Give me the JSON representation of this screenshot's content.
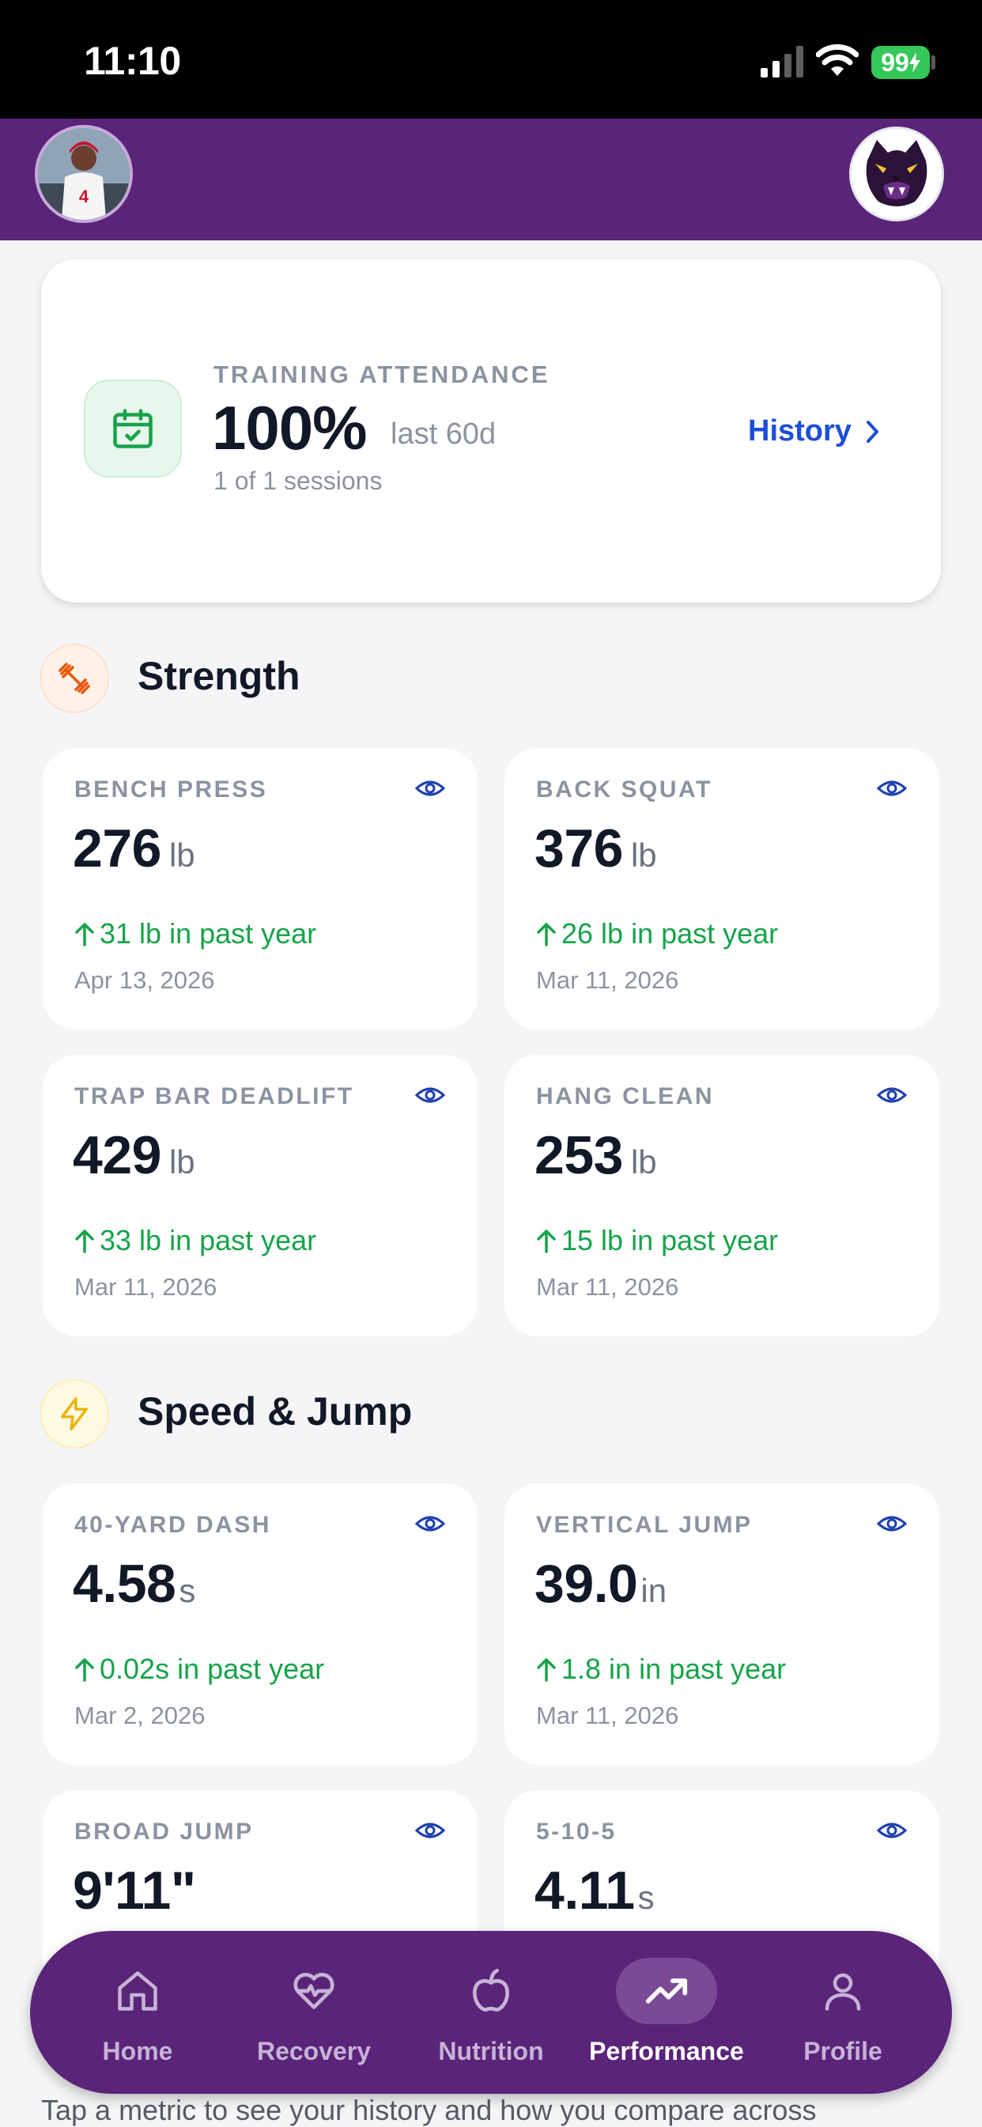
{
  "status_bar": {
    "time": "11:10",
    "battery": "99"
  },
  "attendance": {
    "label": "TRAINING ATTENDANCE",
    "value": "100%",
    "period": "last 60d",
    "sessions": "1 of 1 sessions",
    "history_label": "History"
  },
  "sections": {
    "strength": {
      "title": "Strength"
    },
    "speed": {
      "title": "Speed & Jump"
    }
  },
  "metrics": {
    "bench_press": {
      "label": "BENCH PRESS",
      "value": "276",
      "unit": "lb",
      "change": "31 lb in past year",
      "date": "Apr 13, 2026"
    },
    "back_squat": {
      "label": "BACK SQUAT",
      "value": "376",
      "unit": "lb",
      "change": "26 lb in past year",
      "date": "Mar 11, 2026"
    },
    "trap_bar_deadlift": {
      "label": "TRAP BAR DEADLIFT",
      "value": "429",
      "unit": "lb",
      "change": "33 lb in past year",
      "date": "Mar 11, 2026"
    },
    "hang_clean": {
      "label": "HANG CLEAN",
      "value": "253",
      "unit": "lb",
      "change": "15 lb in past year",
      "date": "Mar 11, 2026"
    },
    "forty_yard_dash": {
      "label": "40-YARD DASH",
      "value": "4.58",
      "unit": "s",
      "change": "0.02s in past year",
      "date": "Mar 2, 2026"
    },
    "vertical_jump": {
      "label": "VERTICAL JUMP",
      "value": "39.0",
      "unit": "in",
      "change": "1.8 in in past year",
      "date": "Mar 11, 2026"
    },
    "broad_jump": {
      "label": "BROAD JUMP",
      "value": "9'11\""
    },
    "five_ten_five": {
      "label": "5-10-5",
      "value": "4.11",
      "unit": "s"
    }
  },
  "hint": "Tap a metric to see your history and how you compare across",
  "nav": {
    "home": "Home",
    "recovery": "Recovery",
    "nutrition": "Nutrition",
    "performance": "Performance",
    "profile": "Profile",
    "active": "performance"
  },
  "colors": {
    "brand_purple": "#5a2479",
    "accent_blue": "#1d4ed8",
    "positive_green": "#16a34a",
    "muted_text": "#8b93a1"
  },
  "icons": {
    "attendance": "calendar-check-icon",
    "strength": "dumbbell-icon",
    "speed": "lightning-icon",
    "view": "eye-icon",
    "change": "arrow-up-icon"
  }
}
